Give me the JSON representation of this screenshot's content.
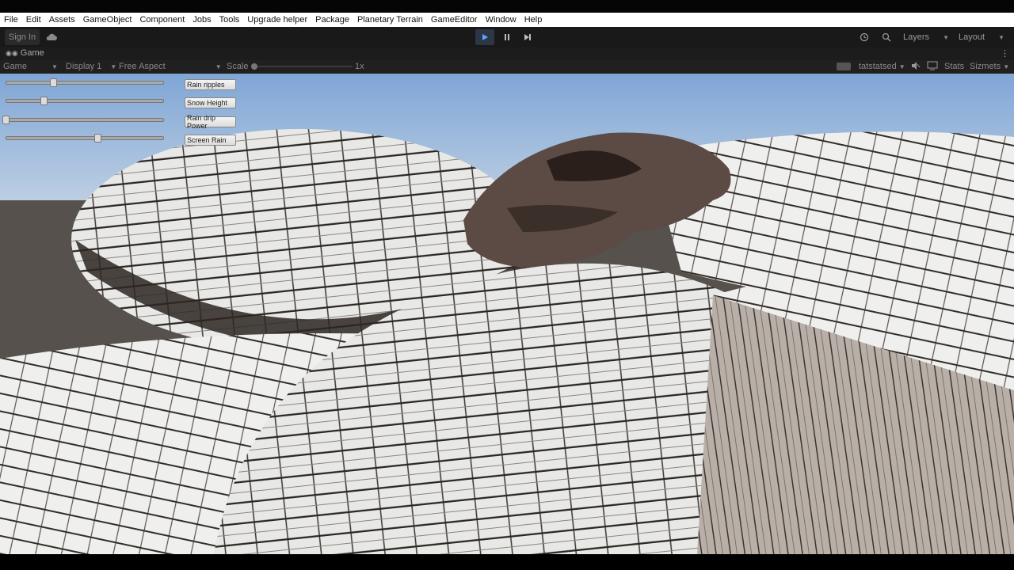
{
  "menubar": {
    "items": [
      "File",
      "Edit",
      "Assets",
      "GameObject",
      "Component",
      "Jobs",
      "Tools",
      "Upgrade helper",
      "Package",
      "Planetary Terrain",
      "GameEditor",
      "Window",
      "Help"
    ]
  },
  "toolbar": {
    "sign_in": "Sign In",
    "layers": "Layers",
    "layout": "Layout",
    "icons": {
      "cloud": "cloud-icon",
      "play": "play-icon",
      "pause": "pause-icon",
      "step": "step-icon",
      "history": "history-icon",
      "search": "search-icon"
    }
  },
  "tab": {
    "title": "Game",
    "more": "⋮"
  },
  "game_toolbar": {
    "mode": "Game",
    "display": "Display 1",
    "aspect": "Free Aspect",
    "scale_label": "Scale",
    "scale_value": "1x",
    "mute_label": "tatstatsed",
    "stats": "Stats",
    "gizmos": "Sizmets"
  },
  "game_ui": {
    "sliders": [
      {
        "name": "rain-ripples-slider",
        "value": 0.3
      },
      {
        "name": "snow-height-slider",
        "value": 0.24
      },
      {
        "name": "rain-drip-power-slider",
        "value": 0.0
      },
      {
        "name": "screen-rain-slider",
        "value": 0.58
      }
    ],
    "buttons": [
      "Rain ripples",
      "Snow Height",
      "Rain drip Power",
      "Screen Rain"
    ]
  },
  "colors": {
    "accent": "#3d6fa8",
    "menubar_bg": "#ffffff",
    "toolbar_bg": "#191919"
  }
}
